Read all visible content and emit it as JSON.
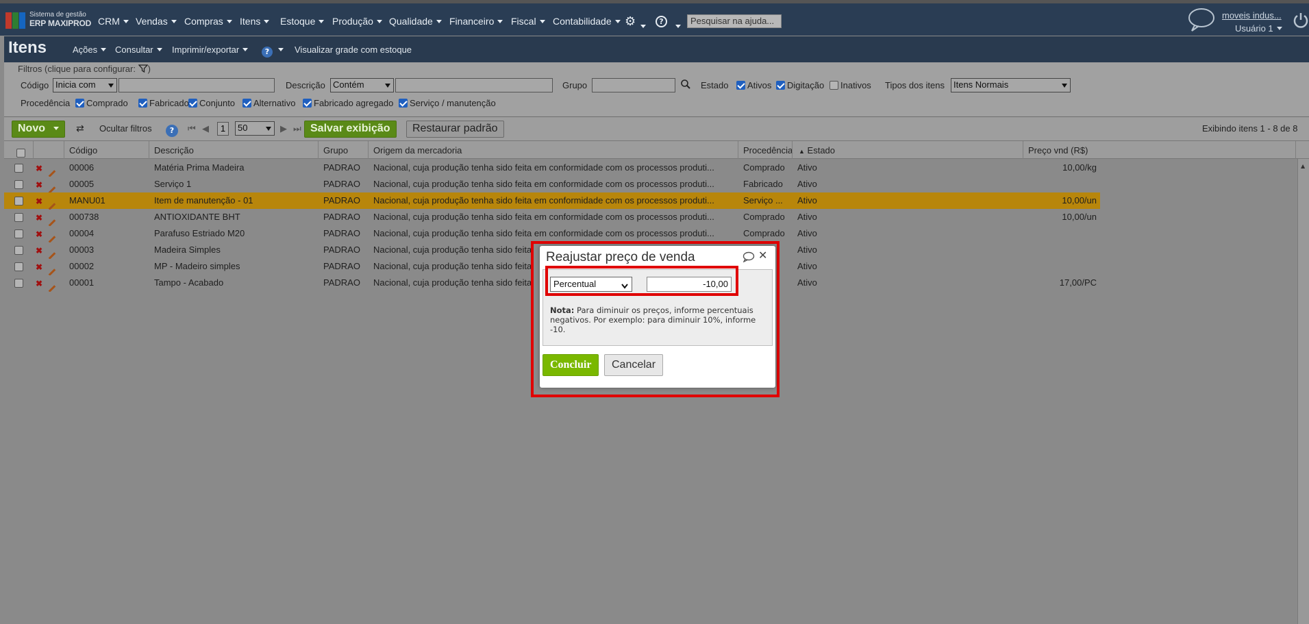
{
  "app": {
    "logo_line1": "Sistema de gestão",
    "logo_line2": "ERP MAXIPROD",
    "logo_colors": [
      "#c0392b",
      "#2e7d32",
      "#1565c0"
    ]
  },
  "nav": {
    "items": [
      "CRM",
      "Vendas",
      "Compras",
      "Itens",
      "Estoque",
      "Produção",
      "Qualidade",
      "Financeiro",
      "Fiscal",
      "Contabilidade"
    ],
    "help_placeholder": "Pesquisar na ajuda...",
    "company": "moveis indus...",
    "user": "Usuário 1"
  },
  "titlebar": {
    "title": "Itens",
    "actions": "Ações",
    "consult": "Consultar",
    "print": "Imprimir/exportar",
    "grid_stock": "Visualizar grade com estoque"
  },
  "filters": {
    "legend": "Filtros (clique para configurar:",
    "codigo_label": "Código",
    "codigo_op": "Inicia com",
    "descricao_label": "Descrição",
    "descricao_op": "Contém",
    "grupo_label": "Grupo",
    "estado_label": "Estado",
    "estado_ativos": "Ativos",
    "estado_digitacao": "Digitação",
    "estado_inativos": "Inativos",
    "tipos_label": "Tipos dos itens",
    "tipos_value": "Itens Normais",
    "procedencia_label": "Procedência",
    "proc": [
      "Comprado",
      "Fabricado",
      "Conjunto",
      "Alternativo",
      "Fabricado agregado",
      "Serviço / manutenção"
    ]
  },
  "toolbar": {
    "new": "Novo",
    "hide_filters": "Ocultar filtros",
    "page": "1",
    "page_size": "50",
    "save_view": "Salvar exibição",
    "restore": "Restaurar padrão",
    "showing": "Exibindo itens 1 - 8 de 8"
  },
  "grid": {
    "headers": [
      "Código",
      "Descrição",
      "Grupo",
      "Origem da mercadoria",
      "Procedência",
      "Estado",
      "Preço vnd (R$)"
    ],
    "rows": [
      {
        "codigo": "00006",
        "descricao": "Matéria Prima Madeira",
        "grupo": "PADRAO",
        "origem": "Nacional, cuja produção tenha sido feita em conformidade com os processos produti...",
        "proc": "Comprado",
        "estado": "Ativo",
        "preco": "10,00/kg"
      },
      {
        "codigo": "00005",
        "descricao": "Serviço 1",
        "grupo": "PADRAO",
        "origem": "Nacional, cuja produção tenha sido feita em conformidade com os processos produti...",
        "proc": "Fabricado",
        "estado": "Ativo",
        "preco": ""
      },
      {
        "codigo": "MANU01",
        "descricao": "Item de manutenção - 01",
        "grupo": "PADRAO",
        "origem": "Nacional, cuja produção tenha sido feita em conformidade com os processos produti...",
        "proc": "Serviço ...",
        "estado": "Ativo",
        "preco": "10,00/un"
      },
      {
        "codigo": "000738",
        "descricao": "ANTIOXIDANTE BHT",
        "grupo": "PADRAO",
        "origem": "Nacional, cuja produção tenha sido feita em conformidade com os processos produti...",
        "proc": "Comprado",
        "estado": "Ativo",
        "preco": "10,00/un"
      },
      {
        "codigo": "00004",
        "descricao": "Parafuso Estriado M20",
        "grupo": "PADRAO",
        "origem": "Nacional, cuja produção tenha sido feita em conformidade com os processos produti...",
        "proc": "Comprado",
        "estado": "Ativo",
        "preco": ""
      },
      {
        "codigo": "00003",
        "descricao": "Madeira Simples",
        "grupo": "PADRAO",
        "origem": "Nacional, cuja produção tenha sido feita",
        "proc": "",
        "estado": "Ativo",
        "preco": ""
      },
      {
        "codigo": "00002",
        "descricao": "MP - Madeiro simples",
        "grupo": "PADRAO",
        "origem": "Nacional, cuja produção tenha sido feita",
        "proc": "",
        "estado": "Ativo",
        "preco": ""
      },
      {
        "codigo": "00001",
        "descricao": "Tampo - Acabado",
        "grupo": "PADRAO",
        "origem": "Nacional, cuja produção tenha sido feita",
        "proc": "",
        "estado": "Ativo",
        "preco": "17,00/PC"
      }
    ],
    "selected_row_color": "#b8860b"
  },
  "modal": {
    "title": "Reajustar preço de venda",
    "type_value": "Percentual",
    "amount_value": "-10,00",
    "note_bold": "Nota:",
    "note_text": " Para diminuir os preços, informe percentuais negativos. Por exemplo: para diminuir 10%, informe -10.",
    "ok": "Concluir",
    "cancel": "Cancelar",
    "highlight_color": "#e00000"
  }
}
